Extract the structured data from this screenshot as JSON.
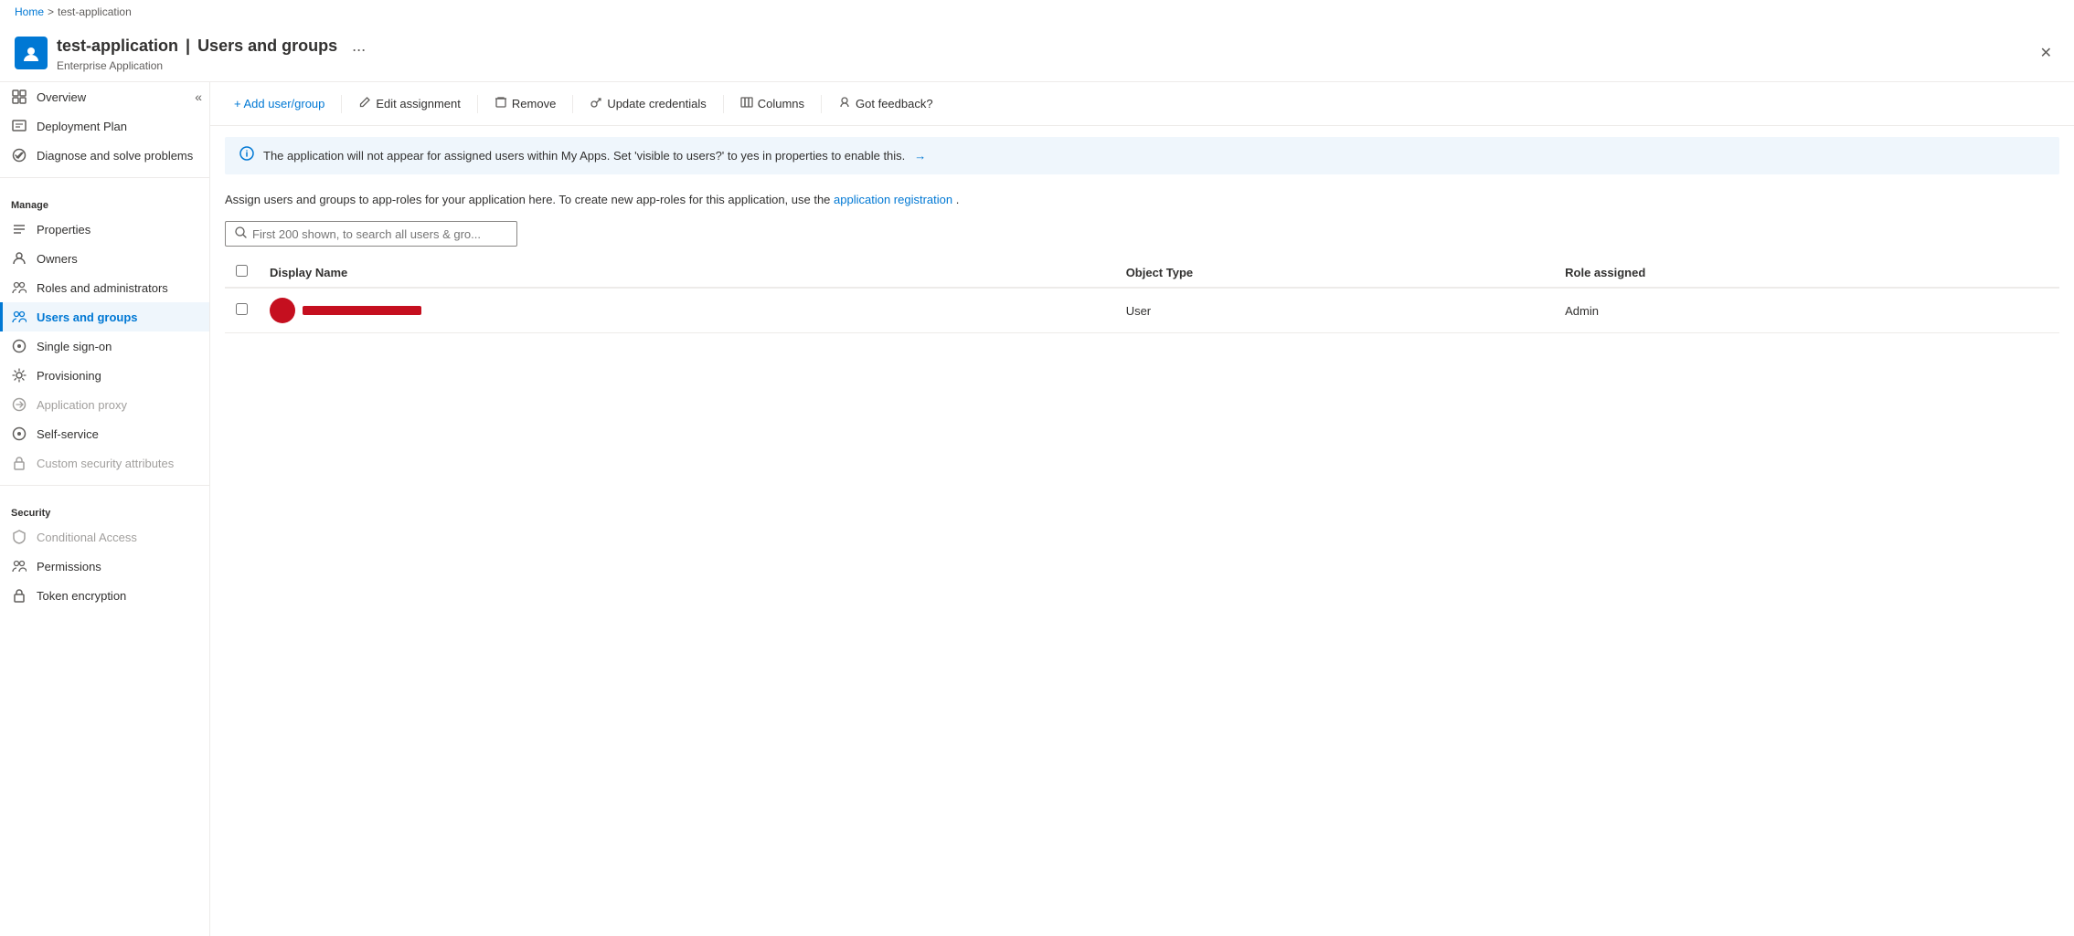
{
  "breadcrumb": {
    "home": "Home",
    "separator": ">",
    "current": "test-application"
  },
  "header": {
    "app_name": "test-application",
    "separator": "|",
    "page_title": "Users and groups",
    "subtitle": "Enterprise Application",
    "more_icon": "...",
    "close_icon": "✕"
  },
  "sidebar": {
    "collapse_icon": "«",
    "items": [
      {
        "id": "overview",
        "label": "Overview",
        "icon": "⊞",
        "active": false,
        "disabled": false
      },
      {
        "id": "deployment-plan",
        "label": "Deployment Plan",
        "icon": "📋",
        "active": false,
        "disabled": false
      },
      {
        "id": "diagnose",
        "label": "Diagnose and solve problems",
        "icon": "🔧",
        "active": false,
        "disabled": false
      }
    ],
    "manage_label": "Manage",
    "manage_items": [
      {
        "id": "properties",
        "label": "Properties",
        "icon": "≡",
        "active": false,
        "disabled": false
      },
      {
        "id": "owners",
        "label": "Owners",
        "icon": "👤",
        "active": false,
        "disabled": false
      },
      {
        "id": "roles-admins",
        "label": "Roles and administrators",
        "icon": "👥",
        "active": false,
        "disabled": false
      },
      {
        "id": "users-groups",
        "label": "Users and groups",
        "icon": "👥",
        "active": true,
        "disabled": false
      },
      {
        "id": "single-sign-on",
        "label": "Single sign-on",
        "icon": "⊙",
        "active": false,
        "disabled": false
      },
      {
        "id": "provisioning",
        "label": "Provisioning",
        "icon": "⚙",
        "active": false,
        "disabled": false
      },
      {
        "id": "app-proxy",
        "label": "Application proxy",
        "icon": "↗",
        "active": false,
        "disabled": true
      },
      {
        "id": "self-service",
        "label": "Self-service",
        "icon": "⊙",
        "active": false,
        "disabled": false
      },
      {
        "id": "custom-security",
        "label": "Custom security attributes",
        "icon": "🔒",
        "active": false,
        "disabled": true
      }
    ],
    "security_label": "Security",
    "security_items": [
      {
        "id": "conditional-access",
        "label": "Conditional Access",
        "icon": "🛡",
        "active": false,
        "disabled": true
      },
      {
        "id": "permissions",
        "label": "Permissions",
        "icon": "👥",
        "active": false,
        "disabled": false
      },
      {
        "id": "token-encryption",
        "label": "Token encryption",
        "icon": "🔒",
        "active": false,
        "disabled": false
      }
    ]
  },
  "toolbar": {
    "add_label": "+ Add user/group",
    "edit_label": "Edit assignment",
    "remove_label": "Remove",
    "update_label": "Update credentials",
    "columns_label": "Columns",
    "feedback_label": "Got feedback?"
  },
  "info_banner": {
    "message": "The application will not appear for assigned users within My Apps. Set 'visible to users?' to yes in properties to enable this.",
    "link_text": "→"
  },
  "description": {
    "text": "Assign users and groups to app-roles for your application here. To create new app-roles for this application, use the ",
    "link_text": "application registration",
    "text_end": "."
  },
  "search": {
    "placeholder": "First 200 shown, to search all users & gro..."
  },
  "table": {
    "columns": [
      "",
      "Display Name",
      "Object Type",
      "Role assigned"
    ],
    "rows": [
      {
        "checked": false,
        "display_name": "[redacted]",
        "object_type": "User",
        "role_assigned": "Admin"
      }
    ]
  }
}
